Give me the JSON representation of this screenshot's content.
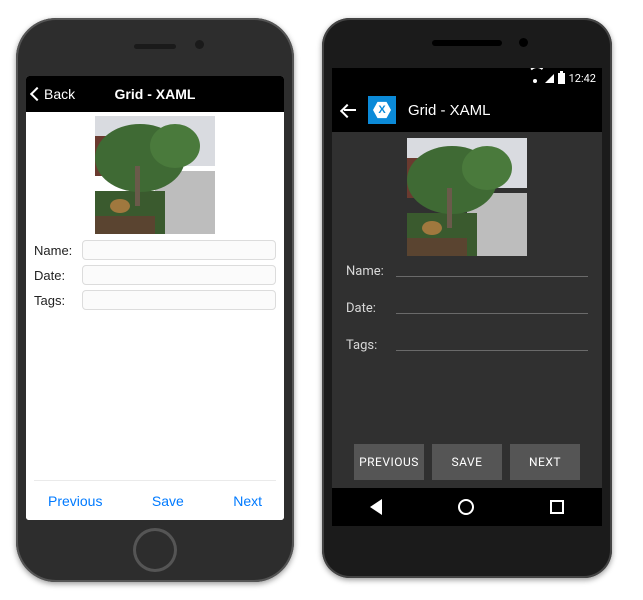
{
  "ios": {
    "nav": {
      "back_label": "Back",
      "title": "Grid - XAML"
    },
    "form": {
      "name_label": "Name:",
      "date_label": "Date:",
      "tags_label": "Tags:",
      "name_value": "",
      "date_value": "",
      "tags_value": ""
    },
    "footer": {
      "previous": "Previous",
      "save": "Save",
      "next": "Next"
    }
  },
  "android": {
    "status": {
      "time": "12:42"
    },
    "nav": {
      "title": "Grid - XAML",
      "app_icon_letter": "X"
    },
    "form": {
      "name_label": "Name:",
      "date_label": "Date:",
      "tags_label": "Tags:",
      "name_value": "",
      "date_value": "",
      "tags_value": ""
    },
    "footer": {
      "previous": "PREVIOUS",
      "save": "SAVE",
      "next": "NEXT"
    }
  },
  "photo": {
    "description": "outdoor-garden-photo",
    "colors": {
      "sky": "#d9dbe0",
      "brick": "#6a3a2f",
      "bush": "#2f5a2b",
      "tree": "#3f6a34",
      "path": "#bdbdbd",
      "mulch": "#5a4430",
      "deer": "#a0783e"
    }
  }
}
